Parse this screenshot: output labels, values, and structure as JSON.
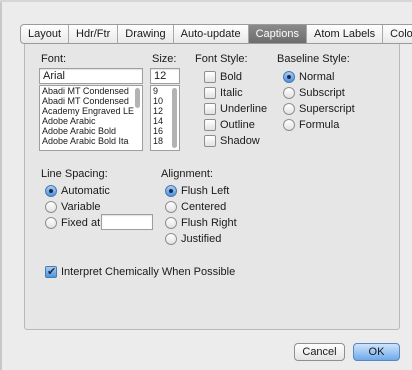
{
  "tabs": [
    {
      "label": "Layout",
      "active": false
    },
    {
      "label": "Hdr/Ftr",
      "active": false
    },
    {
      "label": "Drawing",
      "active": false
    },
    {
      "label": "Auto-update",
      "active": false
    },
    {
      "label": "Captions",
      "active": true
    },
    {
      "label": "Atom Labels",
      "active": false
    },
    {
      "label": "Colors",
      "active": false
    }
  ],
  "font": {
    "label": "Font:",
    "value": "Arial",
    "list": [
      "Abadi MT Condensed",
      "Abadi MT Condensed",
      "Academy Engraved LE",
      "Adobe Arabic",
      "Adobe Arabic Bold",
      "Adobe Arabic Bold Ita"
    ]
  },
  "size": {
    "label": "Size:",
    "value": "12",
    "list": [
      "9",
      "10",
      "12",
      "14",
      "16",
      "18"
    ]
  },
  "font_style": {
    "label": "Font Style:",
    "options": [
      {
        "label": "Bold",
        "checked": false
      },
      {
        "label": "Italic",
        "checked": false
      },
      {
        "label": "Underline",
        "checked": false
      },
      {
        "label": "Outline",
        "checked": false
      },
      {
        "label": "Shadow",
        "checked": false
      }
    ]
  },
  "baseline_style": {
    "label": "Baseline Style:",
    "options": [
      {
        "label": "Normal",
        "selected": true
      },
      {
        "label": "Subscript",
        "selected": false
      },
      {
        "label": "Superscript",
        "selected": false
      },
      {
        "label": "Formula",
        "selected": false
      }
    ]
  },
  "line_spacing": {
    "label": "Line Spacing:",
    "options": [
      {
        "label": "Automatic",
        "selected": true
      },
      {
        "label": "Variable",
        "selected": false
      },
      {
        "label": "Fixed at",
        "selected": false
      }
    ],
    "fixed_value": ""
  },
  "alignment": {
    "label": "Alignment:",
    "options": [
      {
        "label": "Flush Left",
        "selected": true
      },
      {
        "label": "Centered",
        "selected": false
      },
      {
        "label": "Flush Right",
        "selected": false
      },
      {
        "label": "Justified",
        "selected": false
      }
    ]
  },
  "interpret": {
    "label": "Interpret Chemically When Possible",
    "checked": true
  },
  "buttons": {
    "cancel": "Cancel",
    "ok": "OK"
  },
  "colors": {
    "accent": "#4d93e0",
    "active_tab": "#7a7a7a"
  }
}
